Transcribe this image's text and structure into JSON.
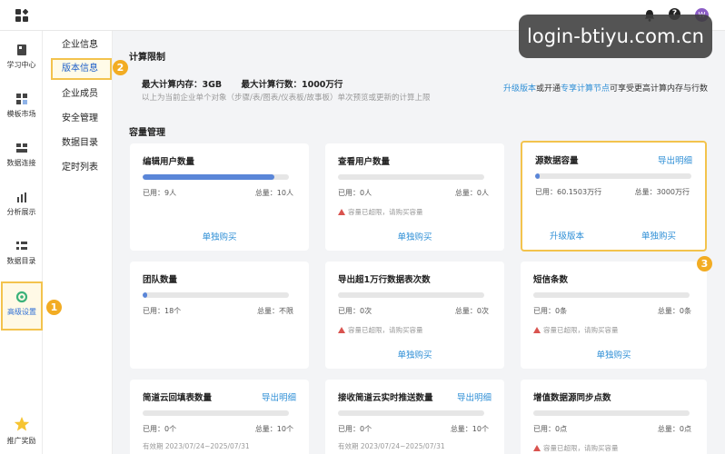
{
  "topbar": {
    "avatar_letter": "W"
  },
  "watermark": "login-btiyu.com.cn",
  "leftnav": [
    {
      "label": "学习中心",
      "icon": "book-icon"
    },
    {
      "label": "模板市场",
      "icon": "template-icon"
    },
    {
      "label": "数据连接",
      "icon": "data-connect-icon"
    },
    {
      "label": "分析展示",
      "icon": "chart-icon"
    },
    {
      "label": "数据目录",
      "icon": "catalog-icon"
    },
    {
      "label": "高级设置",
      "icon": "gear-icon"
    },
    {
      "label": "推广奖励",
      "icon": "star-icon"
    }
  ],
  "subnav": [
    "企业信息",
    "版本信息",
    "企业成员",
    "安全管理",
    "数据目录",
    "定时列表"
  ],
  "badges": [
    "1",
    "2",
    "3"
  ],
  "compute": {
    "title": "计算限制",
    "max_memory": "最大计算内存：3GB",
    "max_rows": "最大计算行数：1000万行",
    "desc": "以上为当前企业单个对象（步骤/表/图表/仪表板/故事板）单次预览或更新的计算上限",
    "upgrade_link": "升级版本",
    "or_open": "或开通",
    "node_link": "专享计算节点",
    "suffix": "可享受更高计算内存与行数"
  },
  "capacity": {
    "title": "容量管理",
    "cards": [
      {
        "title": "编辑用户数量",
        "used": "已用：9人",
        "total": "总量：10人",
        "ratio": 0.9,
        "action": "单独购买"
      },
      {
        "title": "查看用户数量",
        "used": "已用：0人",
        "total": "总量：0人",
        "ratio": 0,
        "warning": "容量已超限，请购买容量",
        "action": "单独购买"
      },
      {
        "title": "源数据容量",
        "link": "导出明细",
        "used": "已用：60.1503万行",
        "total": "总量：3000万行",
        "ratio": 0.02,
        "action_left": "升级版本",
        "action_right": "单独购买"
      },
      {
        "title": "团队数量",
        "used": "已用：18个",
        "total": "总量：不限",
        "ratio": 0.02
      },
      {
        "title": "导出超1万行数据表次数",
        "used": "已用：0次",
        "total": "总量：0次",
        "ratio": 0,
        "warning": "容量已超限，请购买容量",
        "action": "单独购买"
      },
      {
        "title": "短信条数",
        "used": "已用：0条",
        "total": "总量：0条",
        "ratio": 0,
        "warning": "容量已超限，请购买容量",
        "action": "单独购买"
      },
      {
        "title": "简道云回填表数量",
        "link": "导出明细",
        "used": "已用：0个",
        "total": "总量：10个",
        "ratio": 0,
        "validity": "有效期 2023/07/24~2025/07/31"
      },
      {
        "title": "接收简道云实时推送数量",
        "link": "导出明细",
        "used": "已用：0个",
        "total": "总量：10个",
        "ratio": 0,
        "validity": "有效期 2023/07/24~2025/07/31"
      },
      {
        "title": "增值数据源同步点数",
        "used": "已用：0点",
        "total": "总量：0点",
        "ratio": 0,
        "warning": "容量已超限，请购买容量"
      }
    ]
  }
}
